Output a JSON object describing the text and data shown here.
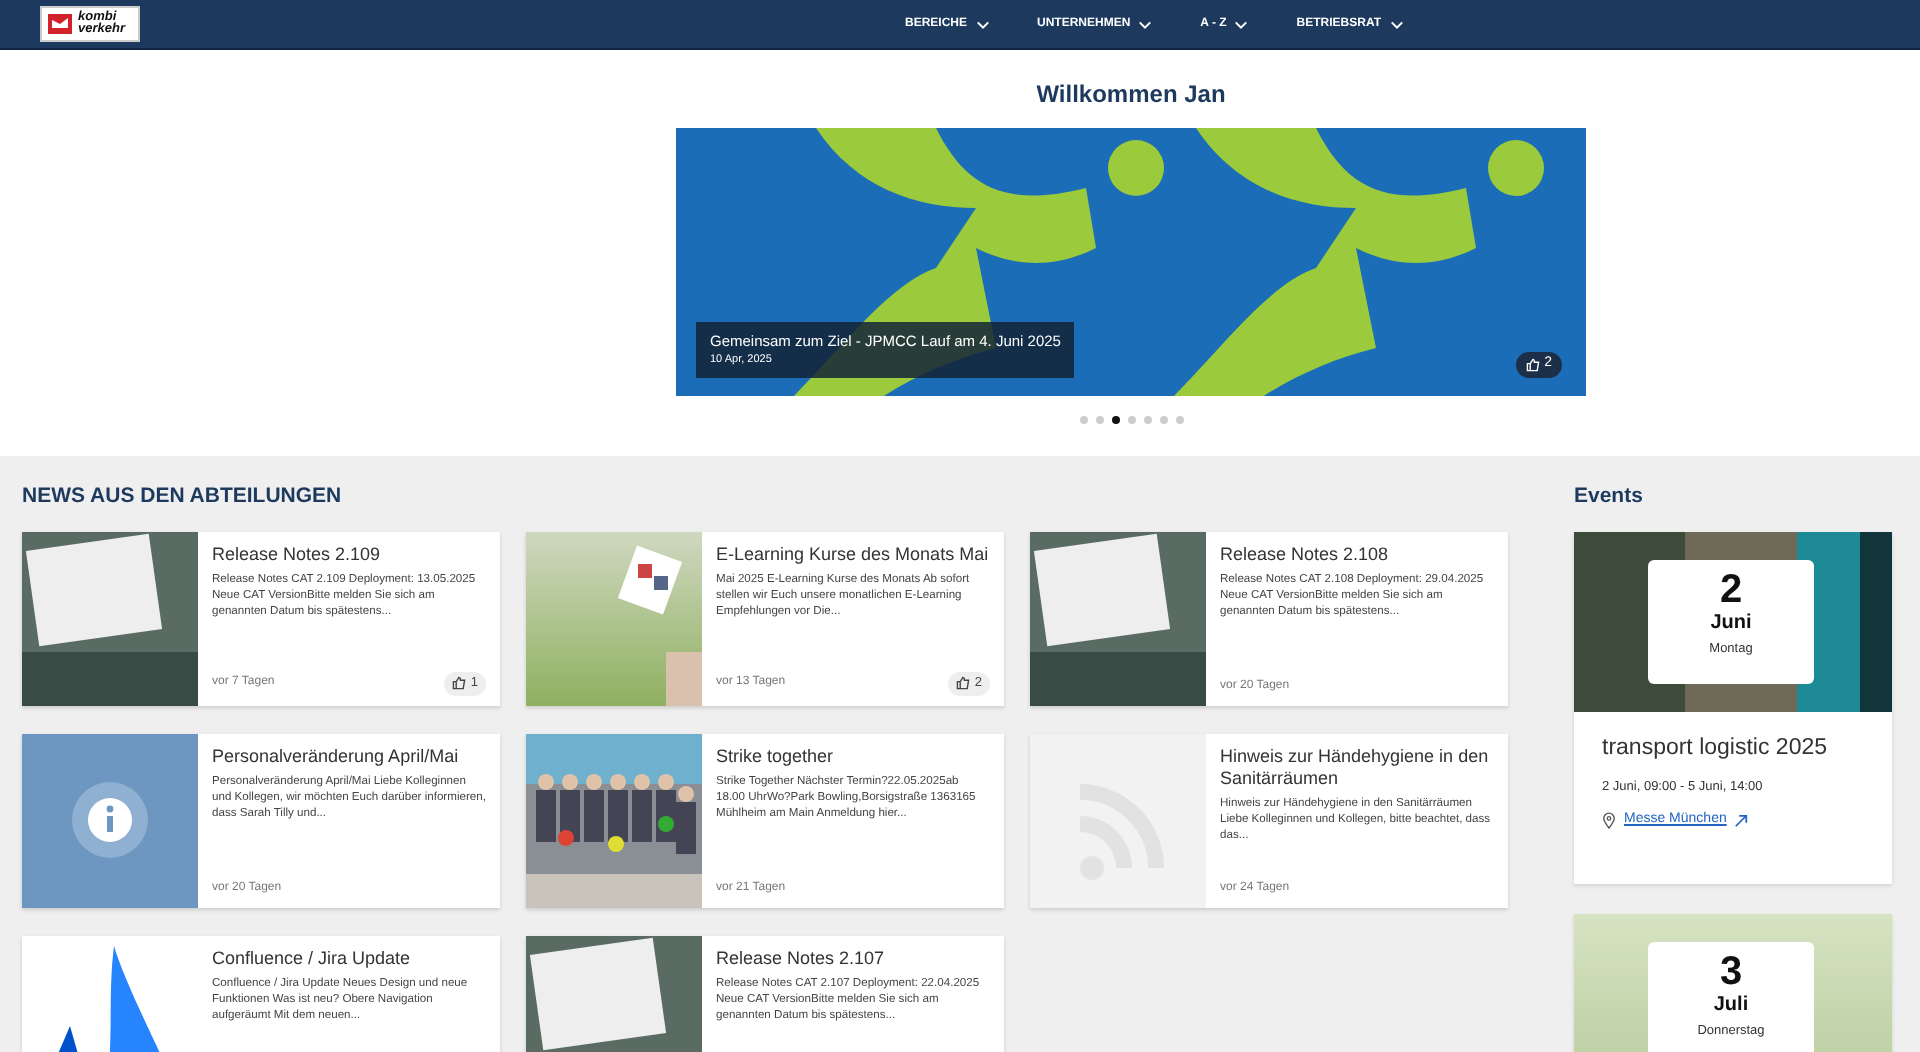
{
  "navbar": {
    "logo": {
      "line_1": "kombi",
      "line_2": "verkehr"
    },
    "items": [
      {
        "label": "BEREICHE"
      },
      {
        "label": "UNTERNEHMEN"
      },
      {
        "label": "A - Z"
      },
      {
        "label": "BETRIEBSRAT"
      }
    ]
  },
  "hero": {
    "greeting": "Willkommen Jan",
    "slide": {
      "title": "Gemeinsam zum Ziel - JPMCC Lauf am 4. Juni 2025",
      "date": "10 Apr, 2025",
      "likes": "2"
    },
    "dots": [
      {
        "selected": false
      },
      {
        "selected": false
      },
      {
        "selected": true
      },
      {
        "selected": false
      },
      {
        "selected": false
      },
      {
        "selected": false
      },
      {
        "selected": false
      }
    ]
  },
  "news": {
    "heading": "NEWS AUS DEN ABTEILUNGEN",
    "cards": [
      {
        "kind": "photo",
        "title": "Release Notes 2.109",
        "excerpt": "Release Notes CAT 2.109 Deployment: 13.05.2025 Neue CAT VersionBitte melden Sie sich am genannten Datum bis spätestens...",
        "age": "vor 7 Tagen",
        "likes": "1"
      },
      {
        "kind": "grass",
        "title": "E-Learning Kurse des Monats Mai",
        "excerpt": "Mai 2025 E-Learning Kurse des Monats Ab sofort stellen wir Euch unsere monatlichen E-Learning Empfehlungen vor Die...",
        "age": "vor 13 Tagen",
        "likes": "2"
      },
      {
        "kind": "photo",
        "title": "Release Notes 2.108",
        "excerpt": "Release Notes CAT 2.108 Deployment: 29.04.2025 Neue CAT VersionBitte melden Sie sich am genannten Datum bis spätestens...",
        "age": "vor 20 Tagen"
      },
      {
        "kind": "info",
        "title": "Personalveränderung April/Mai",
        "excerpt": "Personalveränderung April/Mai Liebe Kolleginnen und Kollegen, wir möchten Euch darüber informieren, dass Sarah Tilly und...",
        "age": "vor 20 Tagen"
      },
      {
        "kind": "group",
        "title": "Strike together",
        "excerpt": "Strike Together Nächster Termin?22.05.2025ab 18.00 UhrWo?Park Bowling,Borsigstraße 1363165 Mühlheim am Main Anmeldung hier...",
        "age": "vor 21 Tagen"
      },
      {
        "kind": "rss",
        "title": "Hinweis zur Händehygiene in den Sanitärräumen",
        "excerpt": "Hinweis zur Händehygiene in den Sanitärräumen Liebe Kolleginnen und Kollegen, bitte beachtet, dass das...",
        "age": "vor 24 Tagen"
      },
      {
        "kind": "atlassian",
        "title": "Confluence / Jira Update",
        "excerpt": "Confluence / Jira Update Neues Design und neue Funktionen Was ist neu? Obere Navigation aufgeräumt Mit dem neuen..."
      },
      {
        "kind": "photo",
        "title": "Release Notes 2.107",
        "excerpt": "Release Notes CAT 2.107 Deployment: 22.04.2025 Neue CAT VersionBitte melden Sie sich am genannten Datum bis spätestens..."
      }
    ]
  },
  "events": {
    "heading": "Events",
    "items": [
      {
        "kind": "aerial",
        "day": "2",
        "month": "Juni",
        "weekday": "Montag",
        "title": "transport logistic 2025",
        "time": "2 Juni, 09:00 - 5 Juni, 14:00",
        "location": "Messe München"
      },
      {
        "kind": "party",
        "day": "3",
        "month": "Juli",
        "weekday": "Donnerstag"
      }
    ]
  }
}
